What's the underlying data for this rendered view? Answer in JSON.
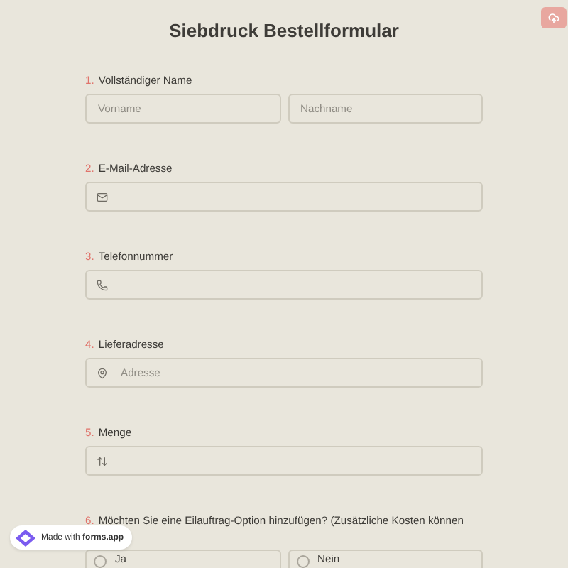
{
  "title": "Siebdruck Bestellformular",
  "questions": [
    {
      "number": "1.",
      "label": "Vollständiger Name",
      "kind": "name",
      "fields": [
        {
          "placeholder": "Vorname"
        },
        {
          "placeholder": "Nachname"
        }
      ]
    },
    {
      "number": "2.",
      "label": "E-Mail-Adresse",
      "kind": "email"
    },
    {
      "number": "3.",
      "label": "Telefonnummer",
      "kind": "phone"
    },
    {
      "number": "4.",
      "label": "Lieferadresse",
      "kind": "address",
      "fields": [
        {
          "placeholder": "Adresse"
        }
      ]
    },
    {
      "number": "5.",
      "label": "Menge",
      "kind": "number"
    },
    {
      "number": "6.",
      "label": "Möchten Sie eine Eilauftrag-Option hinzufügen? (Zusätzliche Kosten können",
      "kind": "radio",
      "options": [
        {
          "label": "Ja",
          "selected": false
        },
        {
          "label": "Nein",
          "selected": false
        }
      ]
    }
  ],
  "badge": {
    "prefix": "Made with",
    "brand": "forms.app"
  }
}
